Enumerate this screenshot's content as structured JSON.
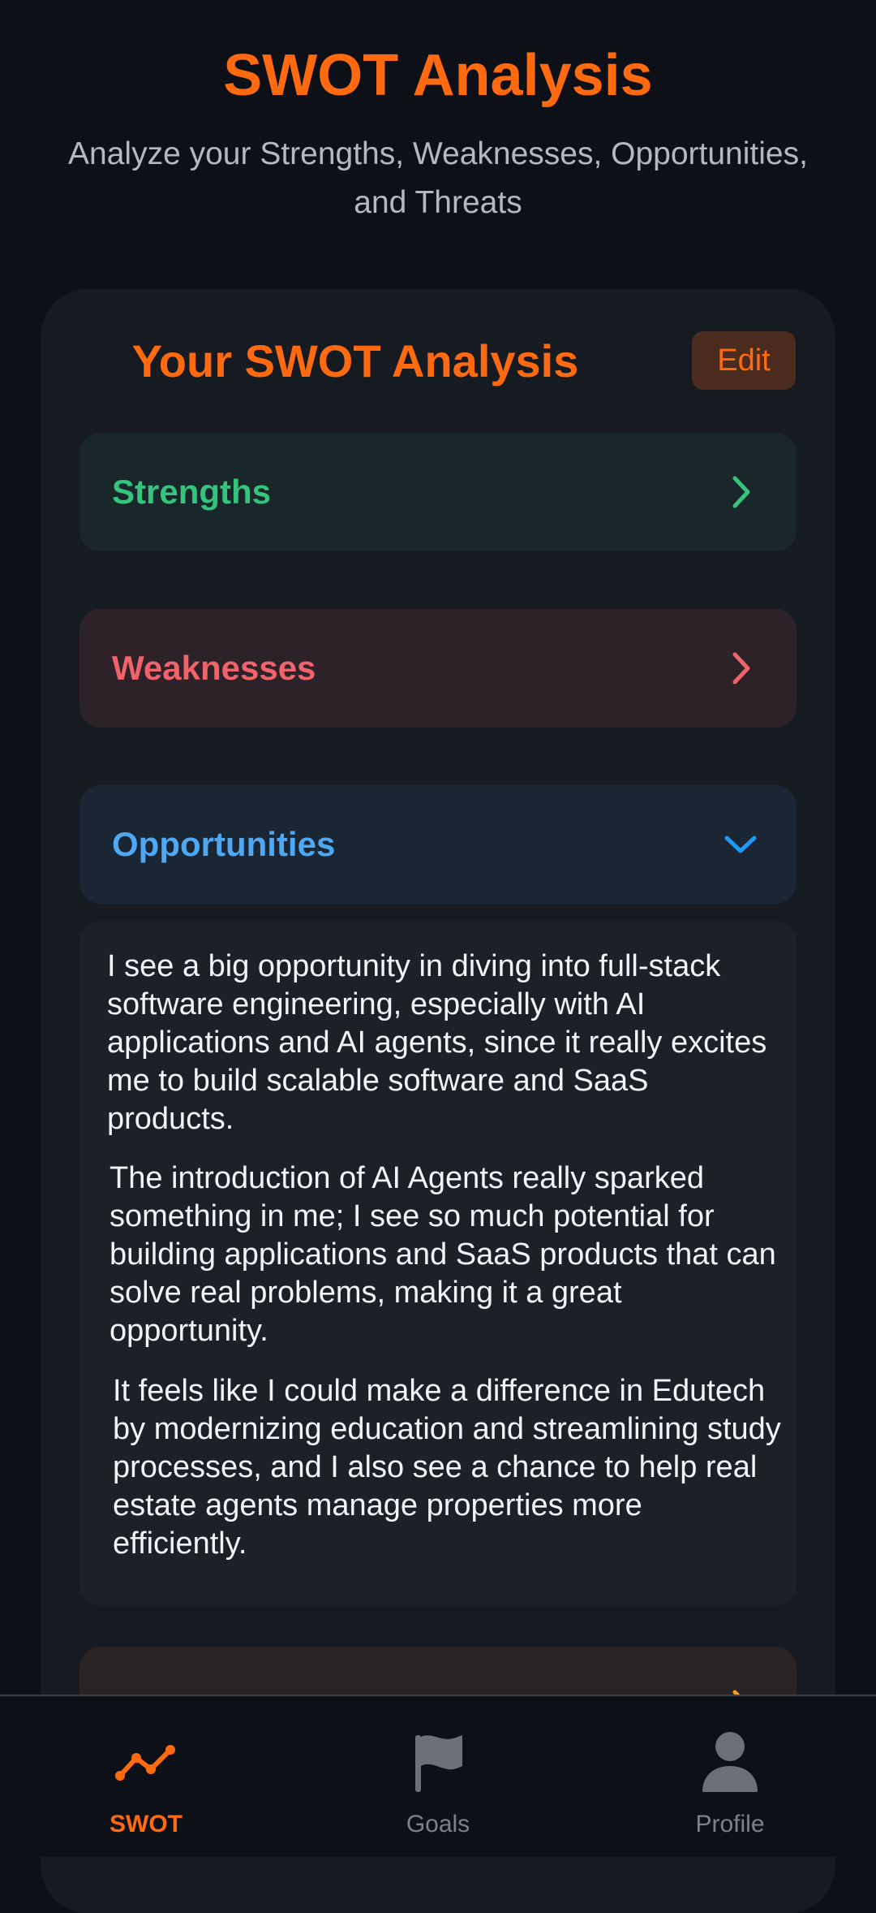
{
  "header": {
    "title": "SWOT Analysis",
    "subtitle": "Analyze your Strengths, Weaknesses, Opportunities, and Threats"
  },
  "card": {
    "title": "Your SWOT Analysis",
    "edit_label": "Edit"
  },
  "sections": {
    "strengths": {
      "label": "Strengths",
      "state": "collapsed",
      "icon": "chevron-right-icon",
      "color": "#34c47c"
    },
    "weaknesses": {
      "label": "Weaknesses",
      "state": "collapsed",
      "icon": "chevron-right-icon",
      "color": "#f0636b"
    },
    "opportunities": {
      "label": "Opportunities",
      "state": "expanded",
      "icon": "chevron-down-icon",
      "color": "#4ea8f4",
      "paragraphs": [
        "I see a big opportunity in diving into full-stack software engineering, especially with AI applications and AI agents, since it really excites me to build scalable software and SaaS products.",
        "The introduction of AI Agents really sparked something in me; I see so much potential for building applications and SaaS products that can solve real problems, making it a great opportunity.",
        "It feels like I could make a difference in Edutech by modernizing education and streamlining study processes, and I also see a chance to help real estate agents manage properties more efficiently."
      ]
    },
    "threats": {
      "state": "collapsed",
      "icon": "chevron-right-icon",
      "color": "#f59a1e"
    }
  },
  "bottom_nav": {
    "items": [
      {
        "label": "SWOT",
        "icon": "trend-line-icon",
        "active": true
      },
      {
        "label": "Goals",
        "icon": "flag-icon",
        "active": false
      },
      {
        "label": "Profile",
        "icon": "person-icon",
        "active": false
      }
    ]
  },
  "colors": {
    "accent": "#ff6a10",
    "background": "#0d1117",
    "card": "#161b22"
  }
}
